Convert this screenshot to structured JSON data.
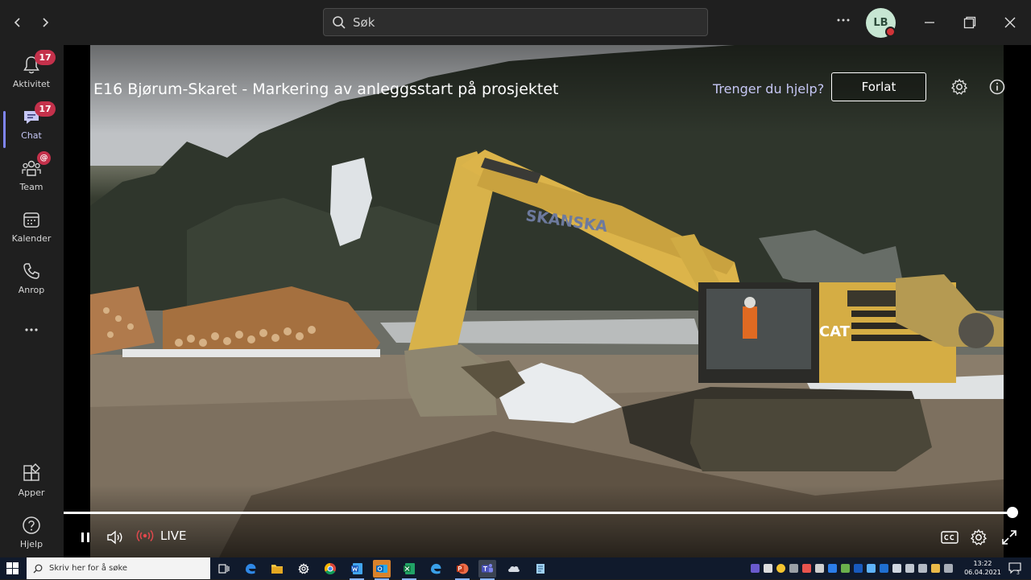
{
  "search": {
    "placeholder": "Søk"
  },
  "user": {
    "initials": "LB"
  },
  "rail": {
    "items": [
      {
        "label": "Aktivitet",
        "badge": "17"
      },
      {
        "label": "Chat",
        "badge": "17"
      },
      {
        "label": "Team",
        "badge": "@"
      },
      {
        "label": "Kalender"
      },
      {
        "label": "Anrop"
      },
      {
        "label": "Apper"
      },
      {
        "label": "Hjelp"
      }
    ]
  },
  "video": {
    "title": "E16 Bjørum-Skaret - Markering av anleggsstart på prosjektet",
    "help_link": "Trenger du hjelp?",
    "leave_label": "Forlat",
    "live_label": "LIVE",
    "progress_fraction": 0.995,
    "scene_labels": {
      "excavator_brand": "SKANSKA",
      "cat_logo": "CAT"
    }
  },
  "taskbar": {
    "search_placeholder": "Skriv her for å søke",
    "time": "13:22",
    "date": "06.04.2021",
    "notification_count": "3"
  },
  "colors": {
    "accent": "#7f85f5",
    "badge": "#c4314b",
    "presence": "#d13438",
    "background": "#1f1f1f"
  }
}
